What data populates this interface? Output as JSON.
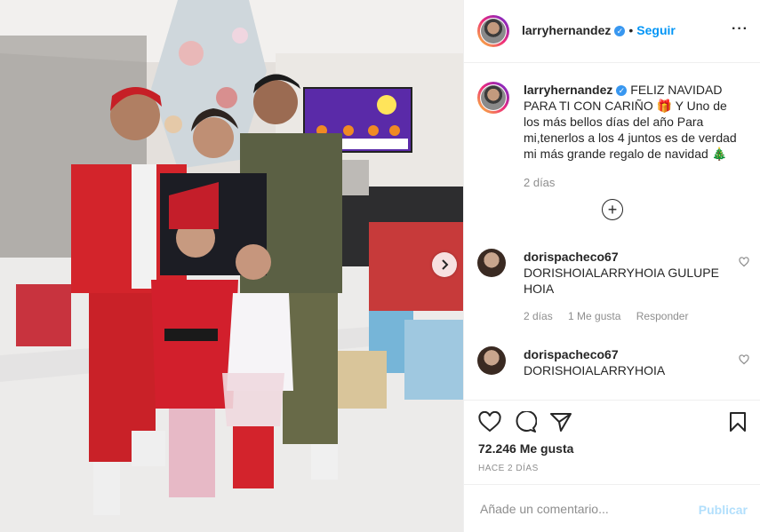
{
  "post": {
    "username": "larryhernandez",
    "follow_label": "Seguir",
    "separator": "•",
    "more_label": "···",
    "caption": "FELIZ NAVIDAD PARA TI CON CARIÑO 🎁 Y Uno de los más bellos días del año Para mi,tenerlos a los 4 juntos es de verdad mi más grande regalo de navidad 🎄",
    "caption_age": "2 días",
    "load_more": "+",
    "likes": "72.246 Me gusta",
    "date": "HACE 2 DÍAS",
    "comment_placeholder": "Añade un comentario...",
    "publish_label": "Publicar",
    "verified_mark": "✓"
  },
  "comments": [
    {
      "username": "dorispacheco67",
      "text": "DORISHOIALARRYHOIA GULUPE HOIA",
      "age": "2 días",
      "likes": "1 Me gusta",
      "reply": "Responder"
    },
    {
      "username": "dorispacheco67",
      "text": "DORISHOIALARRYHOIA"
    }
  ],
  "icons": {
    "like": "heart-icon",
    "comment": "comment-icon",
    "share": "paper-plane-icon",
    "save": "bookmark-icon",
    "more": "ellipsis-icon",
    "next": "chevron-right-icon"
  },
  "colors": {
    "accent": "#0095f6",
    "verified": "#3897f0",
    "muted": "#8e8e8e",
    "publish_disabled": "#b2dffc"
  }
}
